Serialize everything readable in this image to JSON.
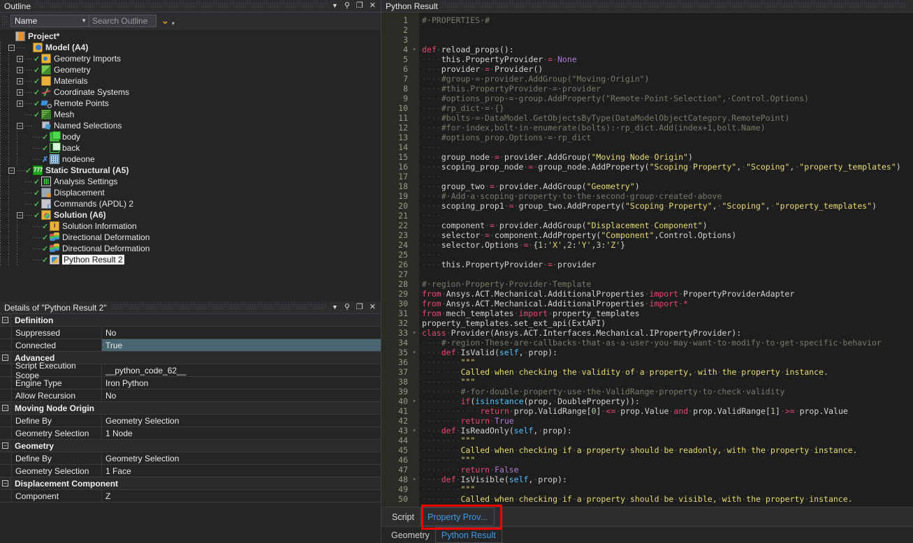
{
  "outline": {
    "title": "Outline",
    "window_buttons": [
      "dropdown-caret",
      "pin",
      "maximize",
      "close"
    ],
    "toolbar": {
      "filter_value": "Name",
      "search_placeholder": "Search Outline",
      "expand_chevron": "chevron-down",
      "more_caret": "caret-down"
    },
    "tree": [
      {
        "label": "Project*",
        "level": 0,
        "icon": "project-icon",
        "bold": true,
        "expander": "none",
        "check": "none"
      },
      {
        "label": "Model (A4)",
        "level": 1,
        "icon": "model-icon",
        "bold": true,
        "expander": "minus",
        "check": "none"
      },
      {
        "label": "Geometry Imports",
        "level": 2,
        "icon": "folder-import-icon",
        "bold": false,
        "expander": "plus",
        "check": "ok"
      },
      {
        "label": "Geometry",
        "level": 2,
        "icon": "geometry-icon",
        "bold": false,
        "expander": "plus",
        "check": "ok"
      },
      {
        "label": "Materials",
        "level": 2,
        "icon": "materials-folder-icon",
        "bold": false,
        "expander": "plus",
        "check": "ok"
      },
      {
        "label": "Coordinate Systems",
        "level": 2,
        "icon": "coordinate-systems-icon",
        "bold": false,
        "expander": "plus",
        "check": "ok"
      },
      {
        "label": "Remote Points",
        "level": 2,
        "icon": "remote-points-icon",
        "bold": false,
        "expander": "plus",
        "check": "ok"
      },
      {
        "label": "Mesh",
        "level": 2,
        "icon": "mesh-icon",
        "bold": false,
        "expander": "none",
        "check": "ok"
      },
      {
        "label": "Named Selections",
        "level": 2,
        "icon": "named-selections-icon",
        "bold": false,
        "expander": "minus",
        "check": "none"
      },
      {
        "label": "body",
        "level": 3,
        "icon": "body-selection-icon",
        "bold": false,
        "expander": "none",
        "check": "ok"
      },
      {
        "label": "back",
        "level": 3,
        "icon": "face-selection-icon",
        "bold": false,
        "expander": "none",
        "check": "ok"
      },
      {
        "label": "nodeone",
        "level": 3,
        "icon": "node-selection-icon",
        "bold": false,
        "expander": "none",
        "check": "x"
      },
      {
        "label": "Static Structural (A5)",
        "level": 1,
        "icon": "static-structural-icon",
        "bold": true,
        "expander": "minus",
        "check": "ok"
      },
      {
        "label": "Analysis Settings",
        "level": 2,
        "icon": "analysis-settings-icon",
        "bold": false,
        "expander": "none",
        "check": "ok"
      },
      {
        "label": "Displacement",
        "level": 2,
        "icon": "displacement-icon",
        "bold": false,
        "expander": "none",
        "check": "ok"
      },
      {
        "label": "Commands (APDL) 2",
        "level": 2,
        "icon": "commands-apdl-icon",
        "bold": false,
        "expander": "none",
        "check": "ok"
      },
      {
        "label": "Solution (A6)",
        "level": 2,
        "icon": "solution-icon",
        "bold": true,
        "expander": "minus",
        "check": "ok"
      },
      {
        "label": "Solution Information",
        "level": 3,
        "icon": "solution-information-icon",
        "bold": false,
        "expander": "none",
        "check": "ok"
      },
      {
        "label": "Directional Deformation",
        "level": 3,
        "icon": "directional-deformation-icon",
        "bold": false,
        "expander": "none",
        "check": "ok"
      },
      {
        "label": "Directional Deformation",
        "level": 3,
        "icon": "directional-deformation-icon",
        "bold": false,
        "expander": "none",
        "check": "ok"
      },
      {
        "label": "Python Result 2",
        "level": 3,
        "icon": "python-result-icon",
        "bold": false,
        "expander": "none",
        "check": "ok",
        "selected": true
      }
    ]
  },
  "details": {
    "title": "Details of \"Python Result 2\"",
    "window_buttons": [
      "dropdown-caret",
      "pin",
      "maximize",
      "close"
    ],
    "rows": [
      {
        "type": "group",
        "label": "Definition"
      },
      {
        "type": "prop",
        "key": "Suppressed",
        "value": "No"
      },
      {
        "type": "prop",
        "key": "Connected",
        "value": "True",
        "highlight": true
      },
      {
        "type": "group",
        "label": "Advanced"
      },
      {
        "type": "prop",
        "key": "Script Execution Scope",
        "value": "__python_code_62__"
      },
      {
        "type": "prop",
        "key": "Engine Type",
        "value": "Iron Python"
      },
      {
        "type": "prop",
        "key": "Allow Recursion",
        "value": "No"
      },
      {
        "type": "group",
        "label": "Moving Node Origin"
      },
      {
        "type": "prop",
        "key": "Define By",
        "value": "Geometry Selection"
      },
      {
        "type": "prop",
        "key": "Geometry Selection",
        "value": "1 Node"
      },
      {
        "type": "group",
        "label": "Geometry"
      },
      {
        "type": "prop",
        "key": "Define By",
        "value": "Geometry Selection"
      },
      {
        "type": "prop",
        "key": "Geometry Selection",
        "value": "1 Face"
      },
      {
        "type": "group",
        "label": "Displacement Component"
      },
      {
        "type": "prop",
        "key": "Component",
        "value": "Z"
      }
    ]
  },
  "editor": {
    "title": "Python Result",
    "code_lines": [
      {
        "n": 1,
        "fold": "",
        "text": "# PROPERTIES #"
      },
      {
        "n": 2,
        "fold": "",
        "text": ""
      },
      {
        "n": 3,
        "fold": "",
        "text": ""
      },
      {
        "n": 4,
        "fold": "-",
        "text": "def reload_props():"
      },
      {
        "n": 5,
        "fold": "",
        "text": "    this.PropertyProvider = None"
      },
      {
        "n": 6,
        "fold": "",
        "text": "    provider = Provider()"
      },
      {
        "n": 7,
        "fold": "",
        "text": "    #group = provider.AddGroup(\"Moving Origin\")"
      },
      {
        "n": 8,
        "fold": "",
        "text": "    #this.PropertyProvider = provider"
      },
      {
        "n": 9,
        "fold": "",
        "text": "    #options_prop = group.AddProperty(\"Remote Point Selection\", Control.Options)"
      },
      {
        "n": 10,
        "fold": "",
        "text": "    #rp_dict = {}"
      },
      {
        "n": 11,
        "fold": "",
        "text": "    #bolts = DataModel.GetObjectsByType(DataModelObjectCategory.RemotePoint)"
      },
      {
        "n": 12,
        "fold": "",
        "text": "    #for index,bolt in enumerate(bolts): rp_dict.Add(index+1,bolt.Name)"
      },
      {
        "n": 13,
        "fold": "",
        "text": "    #options_prop.Options = rp_dict"
      },
      {
        "n": 14,
        "fold": "",
        "text": "    "
      },
      {
        "n": 15,
        "fold": "",
        "text": "    group_node = provider.AddGroup(\"Moving Node Origin\")"
      },
      {
        "n": 16,
        "fold": "",
        "text": "    scoping_prop_node = group_node.AddProperty(\"Scoping Property\", \"Scoping\", \"property_templates\")"
      },
      {
        "n": 17,
        "fold": "",
        "text": "    "
      },
      {
        "n": 18,
        "fold": "",
        "text": "    group_two = provider.AddGroup(\"Geometry\")"
      },
      {
        "n": 19,
        "fold": "",
        "text": "    # Add a scoping property to the second group created above"
      },
      {
        "n": 20,
        "fold": "",
        "text": "    scoping_prop1 = group_two.AddProperty(\"Scoping Property\", \"Scoping\", \"property_templates\")"
      },
      {
        "n": 21,
        "fold": "",
        "text": "    "
      },
      {
        "n": 22,
        "fold": "",
        "text": "    component = provider.AddGroup(\"Displacement Component\")"
      },
      {
        "n": 23,
        "fold": "",
        "text": "    selector = component.AddProperty(\"Component\",Control.Options)"
      },
      {
        "n": 24,
        "fold": "",
        "text": "    selector.Options = {1:'X',2:'Y',3:'Z'}"
      },
      {
        "n": 25,
        "fold": "",
        "text": "    "
      },
      {
        "n": 26,
        "fold": "",
        "text": "    this.PropertyProvider = provider"
      },
      {
        "n": 27,
        "fold": "",
        "text": ""
      },
      {
        "n": 28,
        "fold": "",
        "text": "# region Property Provider Template"
      },
      {
        "n": 29,
        "fold": "",
        "text": "from Ansys.ACT.Mechanical.AdditionalProperties import PropertyProviderAdapter"
      },
      {
        "n": 30,
        "fold": "",
        "text": "from Ansys.ACT.Mechanical.AdditionalProperties import *"
      },
      {
        "n": 31,
        "fold": "",
        "text": "from mech_templates import property_templates"
      },
      {
        "n": 32,
        "fold": "",
        "text": "property_templates.set_ext_api(ExtAPI)"
      },
      {
        "n": 33,
        "fold": "-",
        "text": "class Provider(Ansys.ACT.Interfaces.Mechanical.IPropertyProvider):"
      },
      {
        "n": 34,
        "fold": "",
        "text": "    # region These are callbacks that as a user you may want to modify to get specific behavior"
      },
      {
        "n": 35,
        "fold": "-",
        "text": "    def IsValid(self, prop):"
      },
      {
        "n": 36,
        "fold": "",
        "text": "        \"\"\""
      },
      {
        "n": 37,
        "fold": "",
        "text": "        Called when checking the validity of a property, with the property instance."
      },
      {
        "n": 38,
        "fold": "",
        "text": "        \"\"\""
      },
      {
        "n": 39,
        "fold": "",
        "text": "        # for double property use the ValidRange property to check validity"
      },
      {
        "n": 40,
        "fold": "-",
        "text": "        if(isinstance(prop, DoubleProperty)):"
      },
      {
        "n": 41,
        "fold": "",
        "text": "            return prop.ValidRange[0] <= prop.Value and prop.ValidRange[1] >= prop.Value"
      },
      {
        "n": 42,
        "fold": "",
        "text": "        return True"
      },
      {
        "n": 43,
        "fold": "-",
        "text": "    def IsReadOnly(self, prop):"
      },
      {
        "n": 44,
        "fold": "",
        "text": "        \"\"\""
      },
      {
        "n": 45,
        "fold": "",
        "text": "        Called when checking if a property should be readonly, with the property instance."
      },
      {
        "n": 46,
        "fold": "",
        "text": "        \"\"\""
      },
      {
        "n": 47,
        "fold": "",
        "text": "        return False"
      },
      {
        "n": 48,
        "fold": "-",
        "text": "    def IsVisible(self, prop):"
      },
      {
        "n": 49,
        "fold": "",
        "text": "        \"\"\""
      },
      {
        "n": 50,
        "fold": "",
        "text": "        Called when checking if a property should be visible, with the property instance."
      }
    ],
    "tabs_primary": [
      {
        "label": "Script",
        "active": false
      },
      {
        "label": "Property Prov...",
        "active": true,
        "highlighted": true
      }
    ],
    "tabs_secondary": [
      {
        "label": "Geometry",
        "active": false
      },
      {
        "label": "Python Result",
        "active": true
      }
    ]
  },
  "colors": {
    "accent_blue": "#3d9ae8",
    "highlight_red": "#f00000",
    "row_highlight": "#4a6572",
    "check_green": "#4fbf4f",
    "check_blue": "#4d90d9"
  }
}
